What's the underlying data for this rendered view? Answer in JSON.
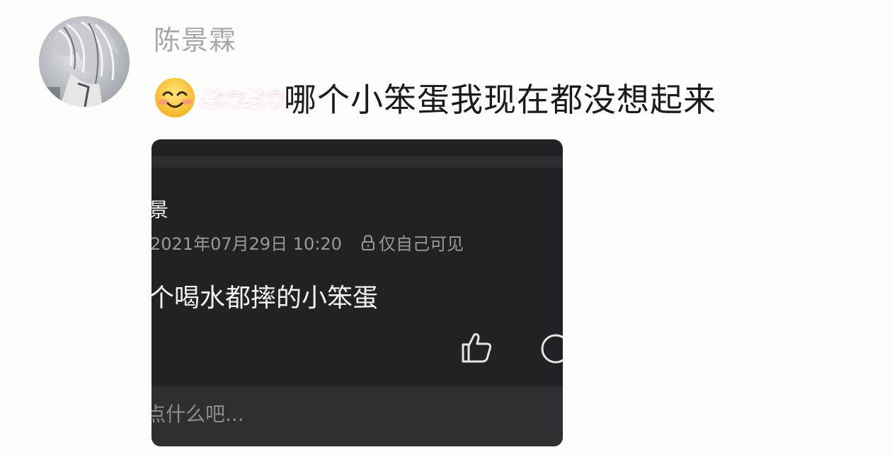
{
  "post": {
    "author": "陈景霖",
    "sticker_text": "给力给力",
    "text": "哪个小笨蛋我现在都没想起来",
    "emoji": "smiling-face-emoji"
  },
  "screenshot": {
    "name_fragment": "景",
    "date": "2021年07月29日 10:20",
    "privacy": "仅自己可见",
    "body": "个喝水都摔的小笨蛋",
    "comment_placeholder": "点什么吧...",
    "icons": [
      "lock-icon",
      "thumbs-up-icon",
      "comment-icon"
    ]
  },
  "colors": {
    "background": "#fdfdfb",
    "username": "#a6a6a6",
    "sticker": "#f0368e",
    "screenshot_bg": "#212224"
  }
}
